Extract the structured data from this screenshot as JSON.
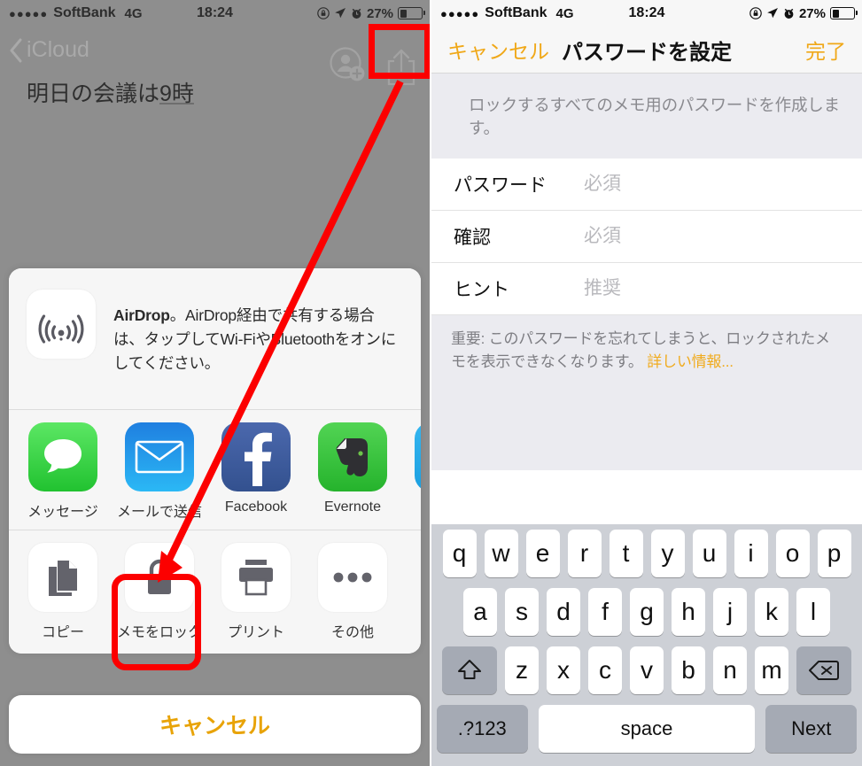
{
  "status_bar": {
    "signal_dots": "●●●●●",
    "carrier": "SoftBank",
    "network": "4G",
    "time": "18:24",
    "battery_percent": "27%",
    "icons": [
      "rotation-lock-icon",
      "location-arrow-icon",
      "alarm-clock-icon",
      "battery-icon"
    ]
  },
  "left_panel": {
    "nav": {
      "back_label": "iCloud",
      "person_add_icon": "person-add-icon",
      "share_icon": "share-icon"
    },
    "note": {
      "title_plain": "明日の会議は",
      "title_underlined": "9時"
    },
    "share_sheet": {
      "airdrop": {
        "bold": "AirDrop",
        "text": "。AirDrop経由で共有する場合は、タップしてWi-FiやBluetoothをオンにしてください。",
        "icon": "airdrop-icon"
      },
      "apps": [
        {
          "label": "メッセージ",
          "icon": "messages-icon"
        },
        {
          "label": "メールで送信",
          "icon": "mail-icon"
        },
        {
          "label": "Facebook",
          "icon": "facebook-icon"
        },
        {
          "label": "Evernote",
          "icon": "evernote-icon"
        },
        {
          "label": "",
          "icon": "twitter-icon"
        }
      ],
      "actions": [
        {
          "label": "コピー",
          "icon": "copy-icon"
        },
        {
          "label": "メモをロック",
          "icon": "lock-icon"
        },
        {
          "label": "プリント",
          "icon": "printer-icon"
        },
        {
          "label": "その他",
          "icon": "ellipsis-icon"
        }
      ],
      "cancel_label": "キャンセル"
    },
    "annotations": {
      "highlight_color": "#fc0000",
      "share_button_highlighted": true,
      "lock_note_highlighted": true,
      "arrow": "red-arrow-from-share-to-lock-note"
    }
  },
  "right_panel": {
    "nav": {
      "cancel_label": "キャンセル",
      "title": "パスワードを設定",
      "done_label": "完了",
      "accent_color": "#f0a818"
    },
    "description": "ロックするすべてのメモ用のパスワードを作成します。",
    "form_rows": [
      {
        "label": "パスワード",
        "placeholder": "必須",
        "value": ""
      },
      {
        "label": "確認",
        "placeholder": "必須",
        "value": ""
      },
      {
        "label": "ヒント",
        "placeholder": "推奨",
        "value": ""
      }
    ],
    "footer": {
      "text": "重要: このパスワードを忘れてしまうと、ロックされたメモを表示できなくなります。",
      "link": "詳しい情報..."
    },
    "keyboard": {
      "row1": [
        "q",
        "w",
        "e",
        "r",
        "t",
        "y",
        "u",
        "i",
        "o",
        "p"
      ],
      "row2": [
        "a",
        "s",
        "d",
        "f",
        "g",
        "h",
        "j",
        "k",
        "l"
      ],
      "row3": [
        "z",
        "x",
        "c",
        "v",
        "b",
        "n",
        "m"
      ],
      "shift_key": "shift-key-icon",
      "backspace_key": "backspace-key-icon",
      "numbers_key": ".?123",
      "space_key": "space",
      "return_key": "Next"
    }
  }
}
